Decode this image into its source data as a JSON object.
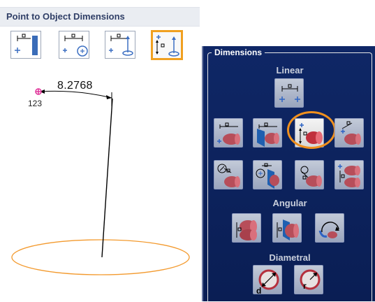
{
  "header": {
    "title": "Point to Object Dimensions"
  },
  "drawing": {
    "dimension_value": "8.2768",
    "point_label": "123"
  },
  "panel": {
    "title": "Dimensions",
    "sections": {
      "linear": "Linear",
      "angular": "Angular",
      "diametral": "Diametral"
    }
  },
  "colors": {
    "highlight": "#f0a020",
    "panel_bg": "#0f2766",
    "ellipse": "#f39a2e",
    "point": "#e0349a"
  }
}
